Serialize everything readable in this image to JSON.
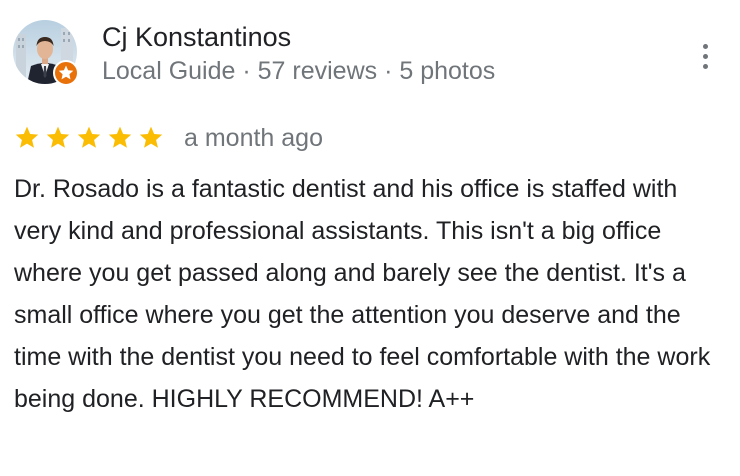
{
  "review": {
    "author": {
      "name": "Cj Konstantinos",
      "meta": "Local Guide · 57 reviews · 5 photos",
      "avatar_icon": "profile-photo",
      "badge_icon": "local-guide-star-badge",
      "badge_color": "#e8710a"
    },
    "rating": {
      "stars": 5,
      "max_stars": 5,
      "star_color": "#fbbc04",
      "date": "a month ago"
    },
    "text": "Dr. Rosado is a fantastic dentist and his office is staffed with very kind and professional assistants. This isn't a big office where you get passed along and barely see the dentist. It's a small office where you get the attention you deserve and the time with the dentist you need to feel comfortable with the work being done. HIGHLY RECOMMEND! A++",
    "menu_icon": "more-vert-icon"
  }
}
